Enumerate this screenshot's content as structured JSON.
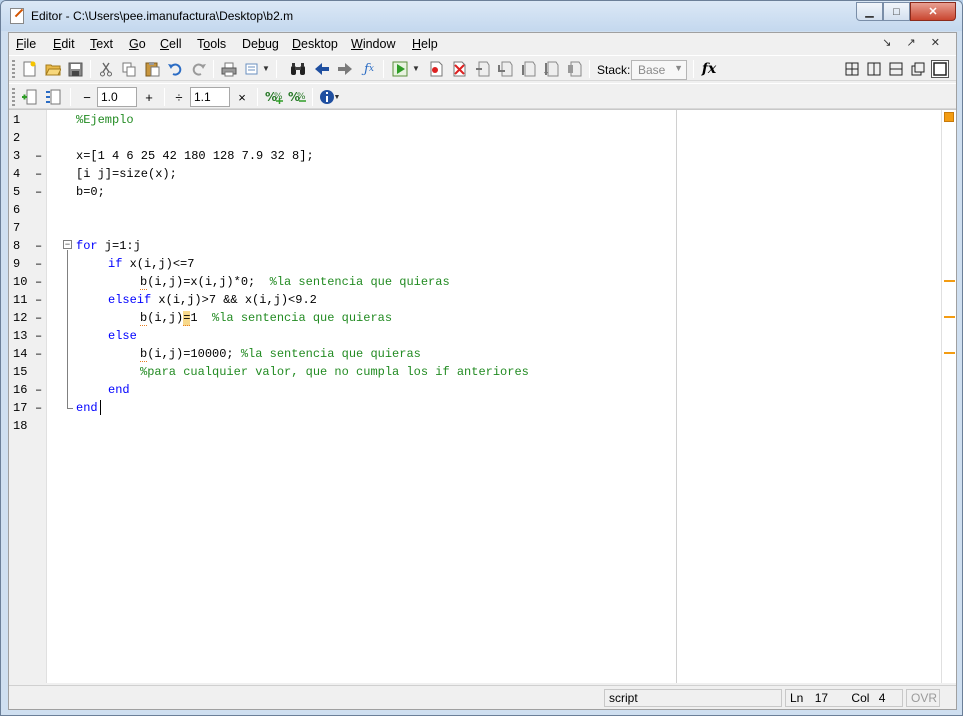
{
  "window": {
    "title": "Editor - C:\\Users\\pee.imanufactura\\Desktop\\b2.m",
    "minimize_glyph": "▁",
    "maximize_glyph": "□",
    "close_glyph": "✕"
  },
  "menu": {
    "items": [
      {
        "key": "F",
        "rest": "ile"
      },
      {
        "key": "E",
        "rest": "dit"
      },
      {
        "key": "T",
        "rest": "ext"
      },
      {
        "key": "G",
        "rest": "o"
      },
      {
        "key": "C",
        "rest": "ell"
      },
      {
        "pre": "T",
        "key": "o",
        "rest": "ols"
      },
      {
        "pre": "De",
        "key": "b",
        "rest": "ug"
      },
      {
        "key": "D",
        "rest": "esktop"
      },
      {
        "key": "W",
        "rest": "indow"
      },
      {
        "key": "H",
        "rest": "elp"
      }
    ],
    "dock_glyphs": "↘ ↗ ✕"
  },
  "toolbar": {
    "stack_label": "Stack:",
    "stack_value": "Base",
    "fx_label": "fx"
  },
  "cell_toolbar": {
    "minus": "−",
    "value1": "1.0",
    "plus": "+",
    "divide": "÷",
    "value2": "1.1",
    "times": "×"
  },
  "code_lines": [
    {
      "n": "1",
      "dash": false
    },
    {
      "n": "2",
      "dash": false
    },
    {
      "n": "3",
      "dash": true
    },
    {
      "n": "4",
      "dash": true
    },
    {
      "n": "5",
      "dash": true
    },
    {
      "n": "6",
      "dash": false
    },
    {
      "n": "7",
      "dash": false
    },
    {
      "n": "8",
      "dash": true
    },
    {
      "n": "9",
      "dash": true
    },
    {
      "n": "10",
      "dash": true
    },
    {
      "n": "11",
      "dash": true
    },
    {
      "n": "12",
      "dash": true
    },
    {
      "n": "13",
      "dash": true
    },
    {
      "n": "14",
      "dash": true
    },
    {
      "n": "15",
      "dash": false
    },
    {
      "n": "16",
      "dash": true
    },
    {
      "n": "17",
      "dash": true
    },
    {
      "n": "18",
      "dash": false
    }
  ],
  "code": {
    "l1": "%Ejemplo",
    "l3": "x=[1 4 6 25 42 180 128 7.9 32 8];",
    "l4": "[i j]=size(x);",
    "l5": "b=0;",
    "l8_kw": "for",
    "l8_rest": " j=1:j",
    "l9_kw": "if",
    "l9_rest": " x(i,j)<=7",
    "l10_a": "b",
    "l10_b": "(i,j)=x(i,j)*0;  ",
    "l10_cm": "%la sentencia que quieras",
    "l11_kw": "elseif",
    "l11_rest": " x(i,j)>7 && x(i,j)<9.2",
    "l12_a": "b",
    "l12_b": "(i,j)",
    "l12_c": "=",
    "l12_d": "1  ",
    "l12_cm": "%la sentencia que quieras",
    "l13_kw": "else",
    "l14_a": "b",
    "l14_b": "(i,j)=10000; ",
    "l14_cm": "%la sentencia que quieras",
    "l15_cm": "%para cualquier valor, que no cumpla los if anteriores",
    "l16_kw": "end",
    "l17_kw": "end"
  },
  "status": {
    "type": "script",
    "ln_label": "Ln",
    "ln_value": "17",
    "col_label": "Col",
    "col_value": "4",
    "ovr": "OVR"
  },
  "colors": {
    "keyword": "#0000ff",
    "comment": "#228b22",
    "warning_marker": "#f39c12"
  }
}
